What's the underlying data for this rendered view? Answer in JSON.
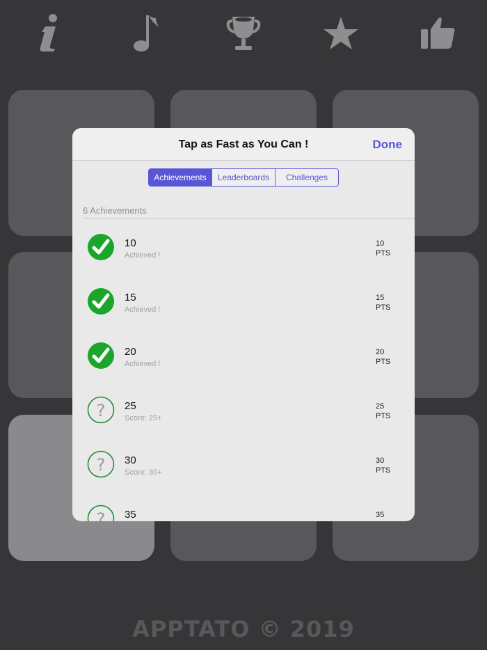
{
  "toolbar": {
    "icons": [
      "info-icon",
      "music-note-icon",
      "trophy-icon",
      "star-icon",
      "thumbs-up-icon"
    ]
  },
  "footer": {
    "text": "APPTATO © 2019"
  },
  "modal": {
    "title": "Tap as Fast as You Can !",
    "done_label": "Done",
    "tabs": [
      {
        "label": "Achievements",
        "active": true
      },
      {
        "label": "Leaderboards",
        "active": false
      },
      {
        "label": "Challenges",
        "active": false
      }
    ],
    "count_label": "6 Achievements",
    "achievements": [
      {
        "title": "10",
        "subtitle": "Achieved !",
        "points": "10",
        "pts_label": "PTS",
        "achieved": true
      },
      {
        "title": "15",
        "subtitle": "Achieved !",
        "points": "15",
        "pts_label": "PTS",
        "achieved": true
      },
      {
        "title": "20",
        "subtitle": "Achieved !",
        "points": "20",
        "pts_label": "PTS",
        "achieved": true
      },
      {
        "title": "25",
        "subtitle": "Score: 25+",
        "points": "25",
        "pts_label": "PTS",
        "achieved": false
      },
      {
        "title": "30",
        "subtitle": "Score: 30+",
        "points": "30",
        "pts_label": "PTS",
        "achieved": false
      },
      {
        "title": "35",
        "subtitle": "",
        "points": "35",
        "pts_label": "",
        "achieved": false
      }
    ]
  },
  "colors": {
    "accent": "#5856d6",
    "achieved_green": "#1aa62a",
    "locked_green": "#1f8a2a"
  }
}
